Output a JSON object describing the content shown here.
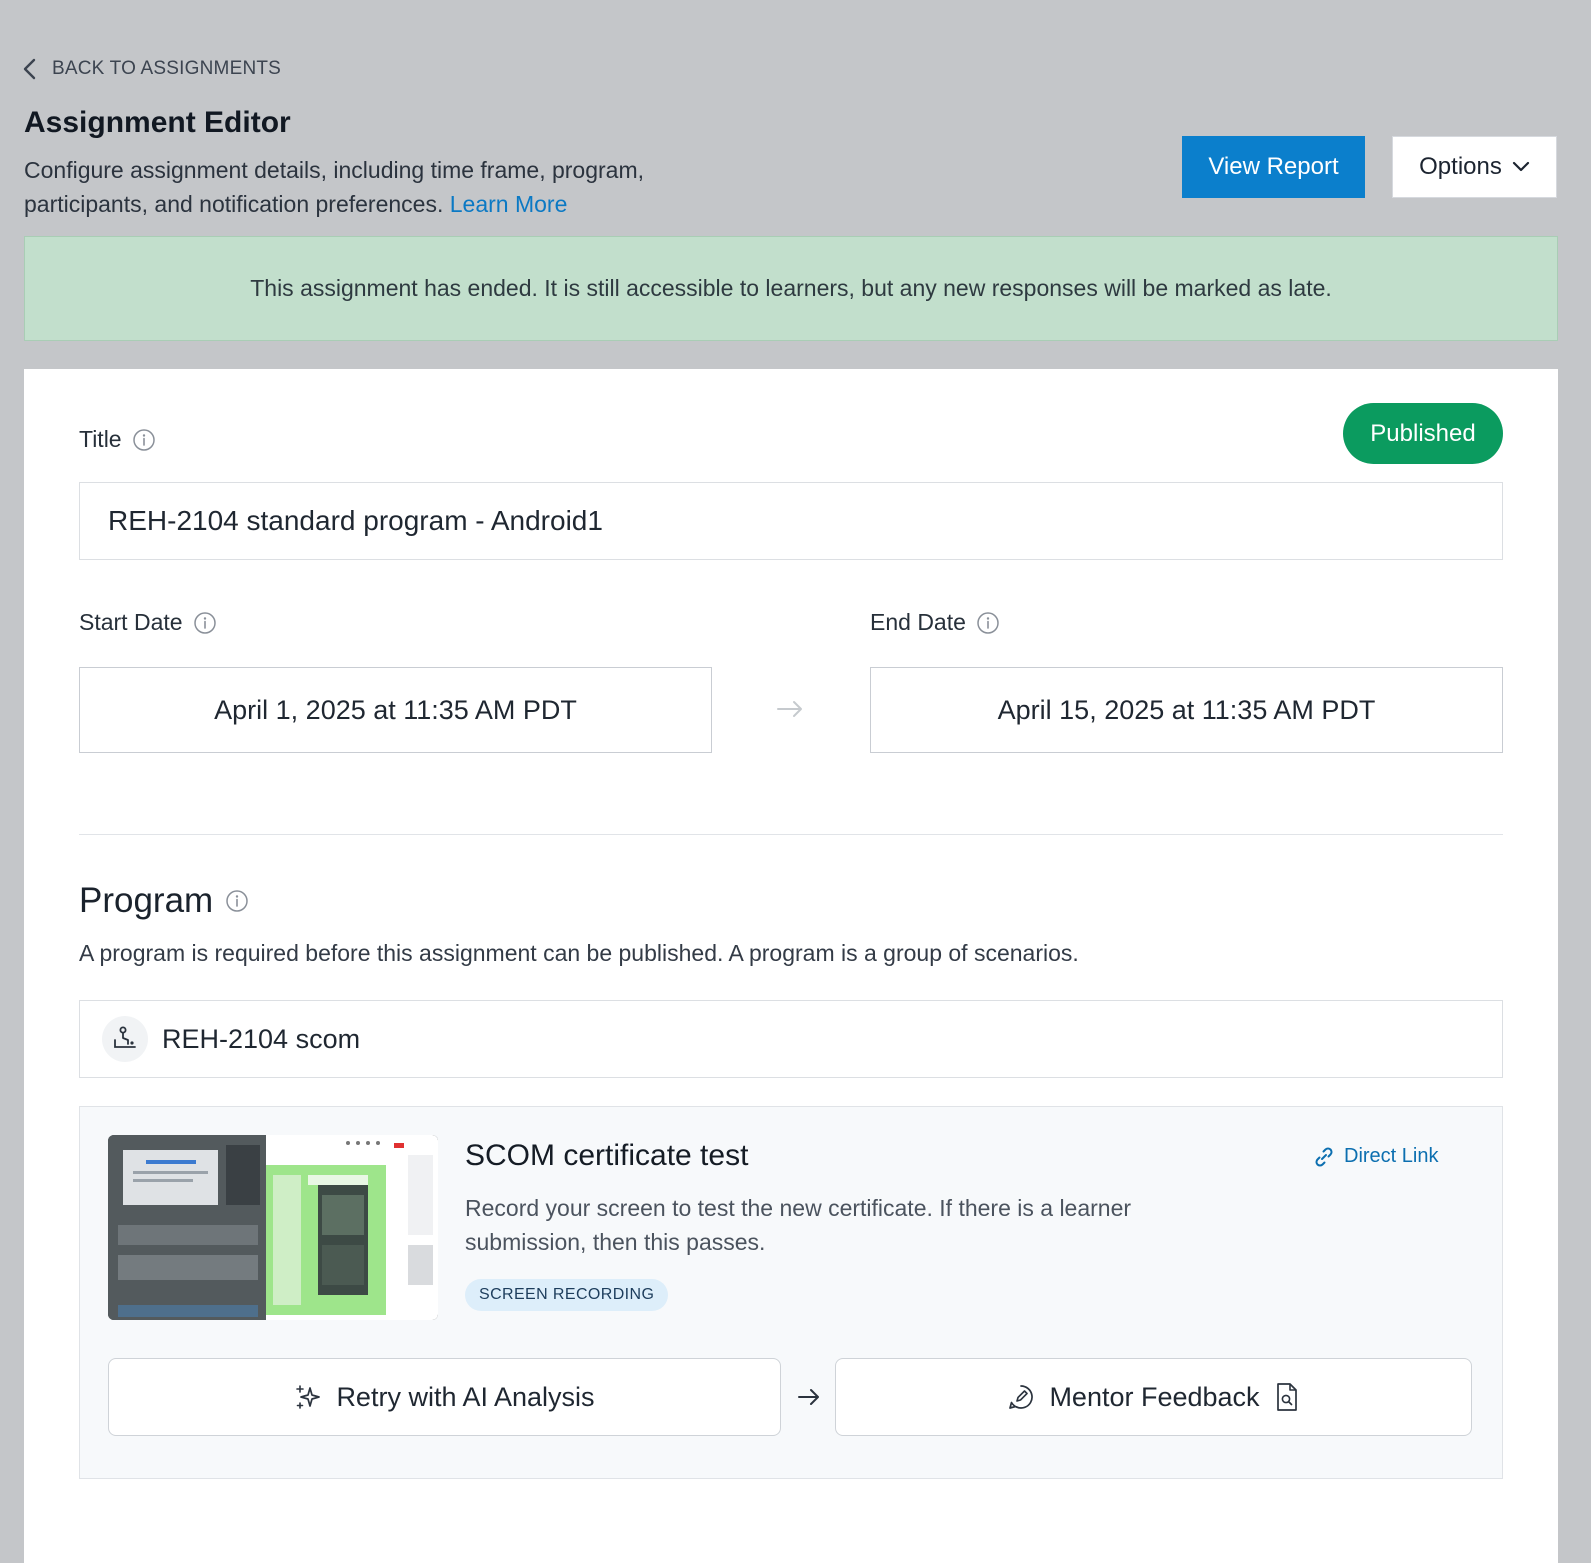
{
  "nav": {
    "back_label": "BACK TO ASSIGNMENTS"
  },
  "header": {
    "title": "Assignment Editor",
    "description": "Configure assignment details, including time frame, program, participants, and notification preferences.",
    "learn_more": "Learn More",
    "view_report": "View Report",
    "options": "Options"
  },
  "banner": {
    "message": "This assignment has ended. It is still accessible to learners, but any new responses will be marked as late."
  },
  "form": {
    "status": "Published",
    "title_label": "Title",
    "title_value": "REH-2104 standard program - Android1",
    "start_label": "Start Date",
    "start_value": "April 1, 2025 at 11:35 AM PDT",
    "end_label": "End Date",
    "end_value": "April 15, 2025 at 11:35 AM PDT"
  },
  "program": {
    "heading": "Program",
    "description": "A program is required before this assignment can be published. A program is a group of scenarios.",
    "selected": "REH-2104 scom"
  },
  "scenario": {
    "title": "SCOM certificate test",
    "description": "Record your screen to test the new certificate. If there is a learner submission, then this passes.",
    "tag": "SCREEN RECORDING",
    "direct_link": "Direct Link",
    "retry_label": "Retry with AI Analysis",
    "mentor_label": "Mentor Feedback"
  },
  "colors": {
    "primary": "#0b7fcc",
    "published": "#0b9b5f",
    "banner_bg": "#c2dfcc",
    "link": "#0b79c4"
  }
}
